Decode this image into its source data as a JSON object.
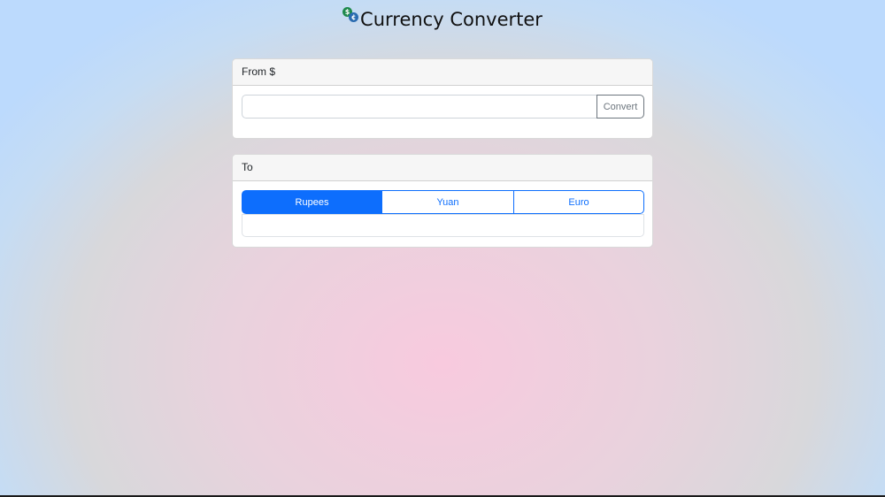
{
  "header": {
    "title": "Currency Converter",
    "logo_icon": "currency-coins-icon",
    "logo_glyphs": [
      "$",
      "¢"
    ]
  },
  "from_card": {
    "header": "From $",
    "input": {
      "value": "",
      "placeholder": ""
    },
    "convert_label": "Convert"
  },
  "to_card": {
    "header": "To",
    "currencies": [
      {
        "label": "Rupees",
        "active": true
      },
      {
        "label": "Yuan",
        "active": false
      },
      {
        "label": "Euro",
        "active": false
      }
    ],
    "result": ""
  },
  "colors": {
    "primary": "#0d6efd",
    "secondary": "#6c757d",
    "bg_center": "#f8cade",
    "bg_edge": "#bcdafd"
  }
}
